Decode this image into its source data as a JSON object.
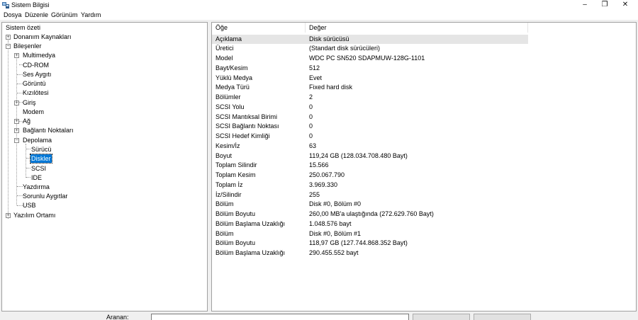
{
  "window": {
    "title": "Sistem Bilgisi",
    "controls": {
      "minimize": "–",
      "maximize": "❐",
      "close": "✕"
    }
  },
  "menu": [
    "Dosya",
    "Düzenle",
    "Görünüm",
    "Yardım"
  ],
  "tree": {
    "root": "Sistem özeti",
    "nodes": [
      {
        "label": "Donanım Kaynakları",
        "expander": "+"
      },
      {
        "label": "Bileşenler",
        "expander": "−"
      },
      {
        "label": "Multimedya",
        "expander": "+"
      },
      {
        "label": "CD-ROM"
      },
      {
        "label": "Ses Aygıtı"
      },
      {
        "label": "Görüntü"
      },
      {
        "label": "Kızılötesi"
      },
      {
        "label": "Giriş",
        "expander": "+"
      },
      {
        "label": "Modem"
      },
      {
        "label": "Ağ",
        "expander": "+"
      },
      {
        "label": "Bağlantı Noktaları",
        "expander": "+"
      },
      {
        "label": "Depolama",
        "expander": "−"
      },
      {
        "label": "Sürücü"
      },
      {
        "label": "Diskler",
        "selected": true
      },
      {
        "label": "SCSI"
      },
      {
        "label": "IDE"
      },
      {
        "label": "Yazdırma"
      },
      {
        "label": "Sorunlu Aygıtlar"
      },
      {
        "label": "USB"
      },
      {
        "label": "Yazılım Ortamı",
        "expander": "+"
      }
    ]
  },
  "table": {
    "columns": [
      "Öğe",
      "Değer"
    ],
    "rows": [
      [
        "Açıklama",
        "Disk sürücüsü"
      ],
      [
        "Üretici",
        "(Standart disk sürücüleri)"
      ],
      [
        "Model",
        "WDC PC SN520 SDAPMUW-128G-1101"
      ],
      [
        "Bayt/Kesim",
        "512"
      ],
      [
        "Yüklü Medya",
        "Evet"
      ],
      [
        "Medya Türü",
        "Fixed hard disk"
      ],
      [
        "Bölümler",
        "2"
      ],
      [
        "SCSI Yolu",
        "0"
      ],
      [
        "SCSI Mantıksal Birimi",
        "0"
      ],
      [
        "SCSI Bağlantı Noktası",
        "0"
      ],
      [
        "SCSI Hedef Kimliği",
        "0"
      ],
      [
        "Kesim/İz",
        "63"
      ],
      [
        "Boyut",
        "119,24 GB (128.034.708.480 Bayt)"
      ],
      [
        "Toplam Silindir",
        "15.566"
      ],
      [
        "Toplam Kesim",
        "250.067.790"
      ],
      [
        "Toplam İz",
        "3.969.330"
      ],
      [
        "İz/Silindir",
        "255"
      ],
      [
        "Bölüm",
        "Disk #0, Bölüm #0"
      ],
      [
        "Bölüm Boyutu",
        "260,00 MB'a ulaştığında (272.629.760 Bayt)"
      ],
      [
        "Bölüm Başlama Uzaklığı",
        "1.048.576 bayt"
      ],
      [
        "Bölüm",
        "Disk #0, Bölüm #1"
      ],
      [
        "Bölüm Boyutu",
        "118,97 GB (127.744.868.352 Bayt)"
      ],
      [
        "Bölüm Başlama Uzaklığı",
        "290.455.552 bayt"
      ]
    ]
  },
  "search": {
    "label": "Aranan:",
    "value": ""
  }
}
